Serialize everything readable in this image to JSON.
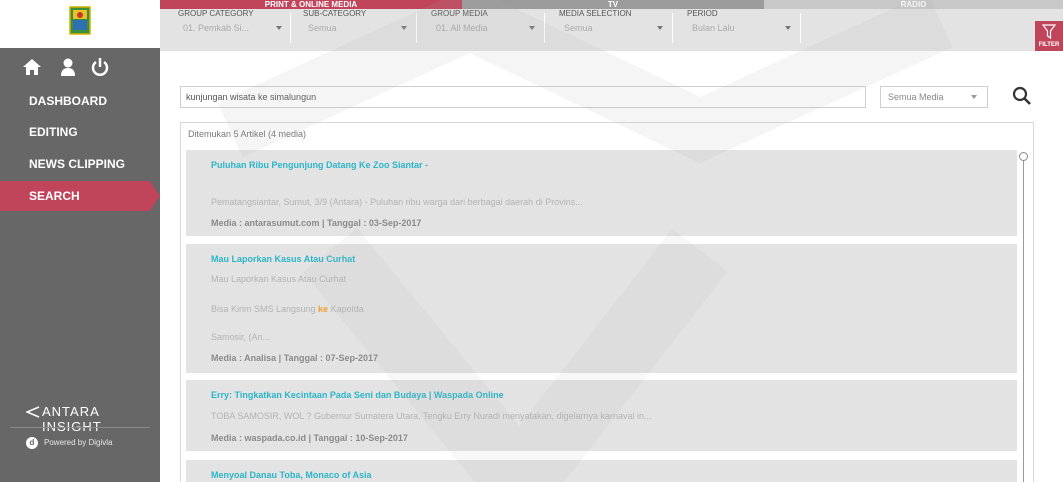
{
  "sidebar": {
    "menu": [
      {
        "label": "DASHBOARD"
      },
      {
        "label": "EDITING"
      },
      {
        "label": "NEWS CLIPPING"
      },
      {
        "label": "SEARCH"
      }
    ],
    "brand": "ANTARA INSIGHT",
    "powered_by": "Powered by Digivla"
  },
  "media_tabs": {
    "print": "PRINT & ONLINE MEDIA",
    "tv": "TV",
    "radio": "RADIO"
  },
  "filters": [
    {
      "label": "GROUP CATEGORY",
      "value": "01. Pemkab Si..."
    },
    {
      "label": "SUB-CATEGORY",
      "value": "Semua"
    },
    {
      "label": "GROUP MEDIA",
      "value": "01. All Media"
    },
    {
      "label": "MEDIA SELECTION",
      "value": "Semua"
    },
    {
      "label": "PERIOD",
      "value": "Bulan Lalu"
    }
  ],
  "filter_button": "FILTER",
  "search": {
    "query": "kunjungan wisata ke simalungun",
    "media_option": "Semua Media"
  },
  "results": {
    "count_text": "Ditemukan 5 Artikel (4 media)",
    "items": [
      {
        "title": "Puluhan Ribu Pengunjung Datang Ke Zoo Siantar -",
        "snippet": "Pematangsiantar, Sumut, 3/9 (Antara) - Puluhan ribu warga dari berbagai daerah di Provins...",
        "meta": "Media : antarasumut.com | Tanggal : 03-Sep-2017"
      },
      {
        "title": "Mau Laporkan Kasus Atau Curhat",
        "line1": "Mau Laporkan Kasus Atau Curhat",
        "line2_pre": "Bisa Kirim SMS Langsung ",
        "line2_hl": "ke",
        "line2_post": " Kapolda",
        "line3": "Samosir, (An...",
        "meta": "Media : Analisa | Tanggal : 07-Sep-2017"
      },
      {
        "title": "Erry: Tingkatkan Kecintaan Pada Seni dan Budaya | Waspada Online",
        "snippet": "TOBA SAMOSIR, WOL ? Gubernur Sumatera Utara, Tengku Erry Nuradi menyatakan, digelarnya karnaval in...",
        "meta": "Media : waspada.co.id | Tanggal : 10-Sep-2017"
      },
      {
        "title": "Menyoal Danau Toba, Monaco of Asia"
      }
    ]
  },
  "colors": {
    "accent": "#c0455b",
    "sidebar": "#676767",
    "title_link": "#2bb5c8",
    "highlight": "#f0a030"
  },
  "icons": [
    "home-icon",
    "user-icon",
    "power-icon",
    "search-icon",
    "filter-icon",
    "antara-logo-icon",
    "digivla-icon"
  ]
}
